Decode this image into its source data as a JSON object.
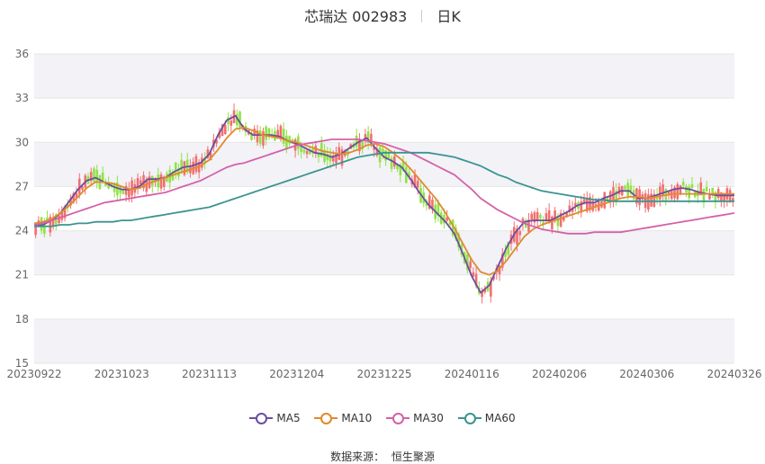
{
  "header": {
    "title": "芯瑞达 002983",
    "period": "日K"
  },
  "footer": {
    "source_label": "数据来源：",
    "source_value": "恒生聚源"
  },
  "colors": {
    "up": "#f26f6f",
    "down": "#8fe345",
    "ma5": "#6b4ea0",
    "ma10": "#e08a30",
    "ma30": "#d660a8",
    "ma60": "#3b9490",
    "grid": "#e6e6e6",
    "band": "#f2f2f7"
  },
  "chart_data": {
    "type": "candlestick",
    "ylim": [
      15,
      36
    ],
    "y_ticks": [
      "15",
      "18",
      "21",
      "24",
      "27",
      "30",
      "33",
      "36"
    ],
    "x_ticks": [
      "20230922",
      "20231023",
      "20231113",
      "20231204",
      "20231225",
      "20240116",
      "20240206",
      "20240306",
      "20240326"
    ],
    "legend": [
      "MA5",
      "MA10",
      "MA30",
      "MA60"
    ],
    "series": [
      {
        "name": "MA5",
        "color": "#6b4ea0",
        "x": [
          0,
          3,
          6,
          9,
          12,
          15,
          18,
          21,
          24,
          27,
          30,
          33,
          36,
          39,
          42,
          45,
          48,
          51,
          54,
          57,
          60,
          63,
          66,
          69,
          72,
          75,
          78,
          81,
          84,
          87,
          90,
          93,
          96,
          99,
          102,
          105,
          108,
          111,
          114,
          117,
          120,
          123,
          126,
          129,
          132,
          135,
          138,
          141,
          144,
          147,
          150,
          153,
          156,
          159,
          162,
          165,
          168,
          171,
          174,
          177,
          180,
          183,
          186,
          189,
          192,
          195,
          198,
          201,
          204,
          207,
          210,
          213,
          216,
          219,
          222,
          225,
          228,
          231,
          234,
          237,
          240
        ],
        "values": [
          24.3,
          24.4,
          24.7,
          25.2,
          26.0,
          26.8,
          27.4,
          27.6,
          27.3,
          27.0,
          26.8,
          26.8,
          27.0,
          27.5,
          27.5,
          27.6,
          28.0,
          28.3,
          28.4,
          28.6,
          29.2,
          30.5,
          31.5,
          31.8,
          30.9,
          30.5,
          30.5,
          30.5,
          30.4,
          30.1,
          29.9,
          29.6,
          29.3,
          29.2,
          29.0,
          29.2,
          29.6,
          30.0,
          30.3,
          29.6,
          29.0,
          28.7,
          28.3,
          27.5,
          26.6,
          25.8,
          25.2,
          24.6,
          23.8,
          22.4,
          20.9,
          19.8,
          20.3,
          21.6,
          22.9,
          23.9,
          24.6,
          24.7,
          24.7,
          24.7,
          25.0,
          25.3,
          25.7,
          25.9,
          25.9,
          26.2,
          26.4,
          26.7,
          26.7,
          26.2,
          26.2,
          26.4,
          26.6,
          26.8,
          26.9,
          26.8,
          26.6,
          26.5,
          26.4,
          26.4,
          26.4
        ]
      },
      {
        "name": "MA10",
        "color": "#e08a30",
        "x": [
          0,
          3,
          6,
          9,
          12,
          15,
          18,
          21,
          24,
          27,
          30,
          33,
          36,
          39,
          42,
          45,
          48,
          51,
          54,
          57,
          60,
          63,
          66,
          69,
          72,
          75,
          78,
          81,
          84,
          87,
          90,
          93,
          96,
          99,
          102,
          105,
          108,
          111,
          114,
          117,
          120,
          123,
          126,
          129,
          132,
          135,
          138,
          141,
          144,
          147,
          150,
          153,
          156,
          159,
          162,
          165,
          168,
          171,
          174,
          177,
          180,
          183,
          186,
          189,
          192,
          195,
          198,
          201,
          204,
          207,
          210,
          213,
          216,
          219,
          222,
          225,
          228,
          231,
          234,
          237,
          240
        ],
        "values": [
          24.5,
          24.6,
          24.8,
          25.2,
          25.7,
          26.3,
          26.9,
          27.3,
          27.3,
          27.2,
          27.0,
          26.8,
          26.9,
          27.2,
          27.4,
          27.6,
          27.8,
          28.0,
          28.2,
          28.4,
          28.8,
          29.5,
          30.3,
          30.9,
          31.0,
          30.8,
          30.5,
          30.4,
          30.3,
          30.1,
          30.0,
          29.8,
          29.6,
          29.4,
          29.3,
          29.2,
          29.3,
          29.5,
          29.8,
          29.9,
          29.7,
          29.3,
          28.8,
          28.2,
          27.5,
          26.8,
          26.1,
          25.2,
          24.2,
          23.1,
          22.0,
          21.2,
          21.0,
          21.3,
          22.0,
          22.8,
          23.6,
          24.1,
          24.4,
          24.6,
          24.8,
          25.0,
          25.2,
          25.4,
          25.6,
          25.8,
          26.0,
          26.2,
          26.3,
          26.3,
          26.2,
          26.3,
          26.4,
          26.5,
          26.5,
          26.5,
          26.5,
          26.5,
          26.5,
          26.5,
          26.5
        ]
      },
      {
        "name": "MA30",
        "color": "#d660a8",
        "x": [
          0,
          3,
          6,
          9,
          12,
          15,
          18,
          21,
          24,
          27,
          30,
          33,
          36,
          39,
          42,
          45,
          48,
          51,
          54,
          57,
          60,
          63,
          66,
          69,
          72,
          75,
          78,
          81,
          84,
          87,
          90,
          93,
          96,
          99,
          102,
          105,
          108,
          111,
          114,
          117,
          120,
          123,
          126,
          129,
          132,
          135,
          138,
          141,
          144,
          147,
          150,
          153,
          156,
          159,
          162,
          165,
          168,
          171,
          174,
          177,
          180,
          183,
          186,
          189,
          192,
          195,
          198,
          201,
          204,
          207,
          210,
          213,
          216,
          219,
          222,
          225,
          228,
          231,
          234,
          237,
          240
        ],
        "values": [
          24.4,
          24.5,
          24.7,
          24.9,
          25.1,
          25.3,
          25.5,
          25.7,
          25.9,
          26.0,
          26.1,
          26.2,
          26.3,
          26.4,
          26.5,
          26.6,
          26.8,
          27.0,
          27.2,
          27.4,
          27.7,
          28.0,
          28.3,
          28.5,
          28.6,
          28.8,
          29.0,
          29.2,
          29.4,
          29.6,
          29.8,
          29.9,
          30.0,
          30.1,
          30.2,
          30.2,
          30.2,
          30.2,
          30.1,
          30.0,
          29.9,
          29.7,
          29.5,
          29.3,
          29.0,
          28.7,
          28.4,
          28.1,
          27.8,
          27.3,
          26.8,
          26.2,
          25.8,
          25.4,
          25.1,
          24.8,
          24.5,
          24.3,
          24.1,
          24.0,
          23.9,
          23.8,
          23.8,
          23.8,
          23.9,
          23.9,
          23.9,
          23.9,
          24.0,
          24.1,
          24.2,
          24.3,
          24.4,
          24.5,
          24.6,
          24.7,
          24.8,
          24.9,
          25.0,
          25.1,
          25.2
        ]
      },
      {
        "name": "MA60",
        "color": "#3b9490",
        "x": [
          0,
          3,
          6,
          9,
          12,
          15,
          18,
          21,
          24,
          27,
          30,
          33,
          36,
          39,
          42,
          45,
          48,
          51,
          54,
          57,
          60,
          63,
          66,
          69,
          72,
          75,
          78,
          81,
          84,
          87,
          90,
          93,
          96,
          99,
          102,
          105,
          108,
          111,
          114,
          117,
          120,
          123,
          126,
          129,
          132,
          135,
          138,
          141,
          144,
          147,
          150,
          153,
          156,
          159,
          162,
          165,
          168,
          171,
          174,
          177,
          180,
          183,
          186,
          189,
          192,
          195,
          198,
          201,
          204,
          207,
          210,
          213,
          216,
          219,
          222,
          225,
          228,
          231,
          234,
          237,
          240
        ],
        "values": [
          24.3,
          24.3,
          24.3,
          24.4,
          24.4,
          24.5,
          24.5,
          24.6,
          24.6,
          24.6,
          24.7,
          24.7,
          24.8,
          24.9,
          25.0,
          25.1,
          25.2,
          25.3,
          25.4,
          25.5,
          25.6,
          25.8,
          26.0,
          26.2,
          26.4,
          26.6,
          26.8,
          27.0,
          27.2,
          27.4,
          27.6,
          27.8,
          28.0,
          28.2,
          28.4,
          28.6,
          28.8,
          29.0,
          29.1,
          29.2,
          29.3,
          29.3,
          29.3,
          29.3,
          29.3,
          29.3,
          29.2,
          29.1,
          29.0,
          28.8,
          28.6,
          28.4,
          28.1,
          27.8,
          27.6,
          27.3,
          27.1,
          26.9,
          26.7,
          26.6,
          26.5,
          26.4,
          26.3,
          26.2,
          26.1,
          26.1,
          26.0,
          26.0,
          26.0,
          26.0,
          26.0,
          26.0,
          26.0,
          26.0,
          26.0,
          26.0,
          26.0,
          26.0,
          26.0,
          26.0,
          26.0
        ]
      }
    ]
  }
}
